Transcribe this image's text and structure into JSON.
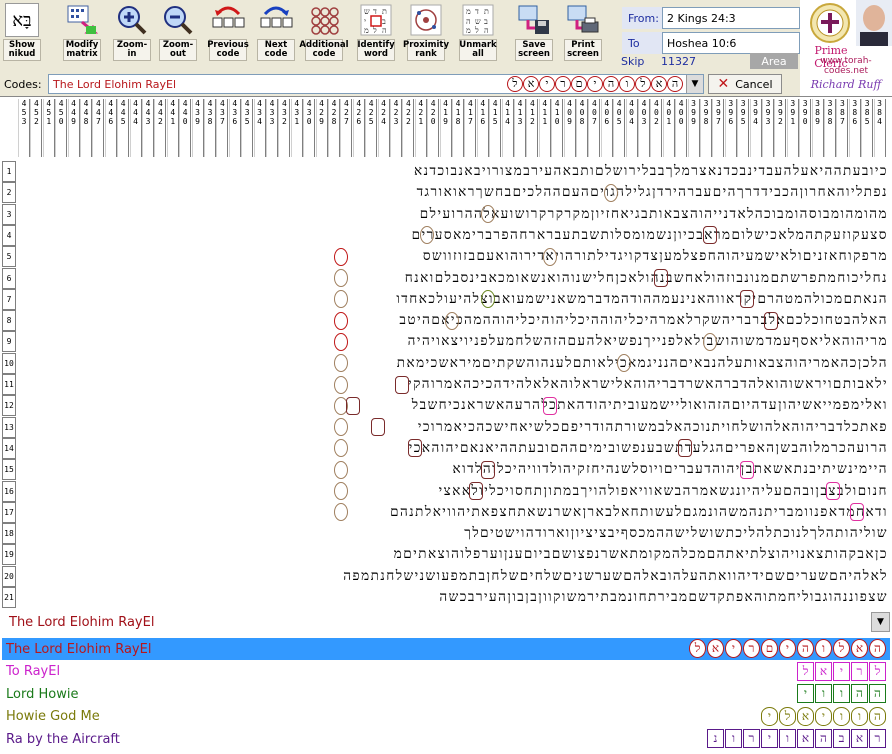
{
  "toolbar": {
    "buttons": [
      {
        "id": "show-nikud",
        "label": "Show\nnikud",
        "icon": "nikud-icon"
      },
      {
        "id": "modify-matrix",
        "label": "Modify\nmatrix",
        "icon": "matrix-icon"
      },
      {
        "id": "zoom-in",
        "label": "Zoom-in",
        "icon": "zoom-in-icon"
      },
      {
        "id": "zoom-out",
        "label": "Zoom-out",
        "icon": "zoom-out-icon"
      },
      {
        "id": "previous-code",
        "label": "Previous\ncode",
        "icon": "previous-icon"
      },
      {
        "id": "next-code",
        "label": "Next\ncode",
        "icon": "next-icon"
      },
      {
        "id": "additional-code",
        "label": "Additional\ncode",
        "icon": "additional-icon"
      },
      {
        "id": "identify-word",
        "label": "Identify\nword",
        "icon": "identify-icon"
      },
      {
        "id": "proximity-rank",
        "label": "Proximity\nrank",
        "icon": "proximity-icon"
      },
      {
        "id": "unmark-all",
        "label": "Unmark\nall",
        "icon": "unmark-icon"
      },
      {
        "id": "save-screen",
        "label": "Save\nscreen",
        "icon": "save-icon"
      },
      {
        "id": "print-screen",
        "label": "Print\nscreen",
        "icon": "print-icon"
      }
    ],
    "nikud_glyph": "בָּא"
  },
  "range": {
    "from_label": "From:",
    "from_value": "2 Kings 24:3",
    "to_label": "To",
    "to_value": "Hoshea 10:6",
    "skip_label": "Skip",
    "skip_value": "11327",
    "area_label": "Area"
  },
  "logo": {
    "title": "Prime Cleric",
    "url": "www.torah-codes.net",
    "signature": "Richard Ruff"
  },
  "codes": {
    "label": "Codes:",
    "selected": "The Lord Elohim RayEl",
    "selected_hebrew": [
      "ה",
      "א",
      "ל",
      "ו",
      "ה",
      "י",
      "ם",
      "ר",
      "י",
      "א",
      "ל"
    ],
    "cancel_label": "Cancel"
  },
  "matrix": {
    "column_numbers": [
      "4\n5\n3",
      "4\n5\n2",
      "4\n5\n1",
      "4\n5\n0",
      "4\n4\n9",
      "4\n4\n8",
      "4\n4\n7",
      "4\n4\n6",
      "4\n4\n5",
      "4\n4\n4",
      "4\n4\n3",
      "4\n4\n2",
      "4\n4\n1",
      "4\n4\n0",
      "4\n3\n9",
      "4\n3\n8",
      "4\n3\n7",
      "4\n3\n6",
      "4\n3\n5",
      "4\n3\n4",
      "4\n3\n3",
      "4\n3\n2",
      "4\n3\n1",
      "4\n3\n0",
      "4\n2\n9",
      "4\n2\n8",
      "4\n2\n7",
      "4\n2\n6",
      "4\n2\n5",
      "4\n2\n4",
      "4\n2\n3",
      "4\n2\n2",
      "4\n2\n1",
      "4\n2\n0",
      "4\n1\n9",
      "4\n1\n8",
      "4\n1\n7",
      "4\n1\n6",
      "4\n1\n5",
      "4\n1\n4",
      "4\n1\n3",
      "4\n1\n2",
      "4\n1\n1",
      "4\n1\n0",
      "4\n0\n9",
      "4\n0\n8",
      "4\n0\n7",
      "4\n0\n6",
      "4\n0\n5",
      "4\n0\n4",
      "4\n0\n3",
      "4\n0\n2",
      "4\n0\n1",
      "4\n0\n0",
      "3\n9\n9",
      "3\n9\n8",
      "3\n9\n7",
      "3\n9\n6",
      "3\n9\n5",
      "3\n9\n4",
      "3\n9\n3",
      "3\n9\n2",
      "3\n9\n1",
      "3\n9\n0",
      "3\n8\n9",
      "3\n8\n8",
      "3\n8\n7",
      "3\n8\n6",
      "3\n8\n5",
      "3\n8\n4"
    ],
    "rows": [
      {
        "n": "1",
        "text": "כיובעתההיאעלהעבדינבכדנאצרמלךבבלירושלםותבאהעירבמצורויבאנבוכדנא"
      },
      {
        "n": "2",
        "text": "נפתליוהאחרוןהכבידדרךהיםעברהירדןגלילהגויםהעםההלכיםבחשךראואורגד"
      },
      {
        "n": "3",
        "text": "מהומהומבוסהומבוכהלאדנייהוהצבאותבגיאחזיוןמקרקרקרושועאלההרועילם"
      },
      {
        "n": "4",
        "text": "סצעקוזעקתהמלאכישלוםמראבכיוןנשמומסלותשבתעברארחהפרברימאסערים"
      },
      {
        "n": "5",
        "text": "מרפקוחאזניםולאישמעיהוהחפצלמעןצדקויגדילתורהויאדירוהואעםבזוזוושס"
      },
      {
        "n": "6",
        "text": "נחליכוחמתפרשתםמנונבוזהולאחשבנהולאכןחלישנוהואנשאומכאבינסבלםואנח"
      },
      {
        "n": "7",
        "text": "הנאתםמכולהמטהרםיקראווהאנינעמההודהמדברמשאנישמעואבוצלהיעולכאחדו"
      },
      {
        "n": "8",
        "text": "האלהבטחוכלכםאלברבריהשקרלאמרהיכליהוההיכליהוהיכליהוההמהכיאםהיטב"
      },
      {
        "n": "9",
        "text": "מריהוהאליאסףעמדמשוהושבולאלפנייךנפשיאלהעםהזהשלחמעלפניויצאויהיה"
      },
      {
        "n": "10",
        "text": "הלכןכהאמריהוהצבאותעלהנבאיםהנניגמאכילאותםלענהוהשקתיםמיראשכימאת"
      },
      {
        "n": "11",
        "text": "ילאבותםויראשוהואלהדברהאשרדבריהוהאלישראלוהאלאלהידהכיכהאמרוהקי"
      },
      {
        "n": "12",
        "text": "ואלימפמייאשיהוןעדהיוםהזהואוליישמעוביתיהודהאתכלהרעהאשראנכיחשבל"
      },
      {
        "n": "13",
        "text": "פאתכלדבריהוהאלהושלחויתנוכהאלבמשורתהודריפםכלשיאחישכהכיאמרוכי"
      },
      {
        "n": "14",
        "text": "הרועהכרמלוהבשןהאפריםהגלעדתשבענפשובימיםההםובעתההיאנאםיהוהאכי"
      },
      {
        "n": "15",
        "text": "היימינשיתיבנתאשאתבןיהוהדעבריםויוסלשנהיחזקיהולדוויהיכלוהלדוא"
      },
      {
        "n": "16",
        "text": "חנוםולבצבןובהםעליהיונגשאמרהבשאוויאפולהויךבמתוןתחסויכליולאאצי"
      },
      {
        "n": "17",
        "text": "ודאחמדאפנוומבריתנהמשהונמגםלעשותחאלבארןאשרנשאתחצפאתיהוויאלתנהם"
      },
      {
        "n": "18",
        "text": "שוליהותהלךלנוכתלהליכתשושלישההמכסףיבציציוןוארודהוישטיםלך"
      },
      {
        "n": "19",
        "text": "כןאבקהותצאנויהוצלתיאתהםמכלהמקומתאשרנפצושםביוםענןוערפלוהוצאתיםמ"
      },
      {
        "n": "20",
        "text": "לאלהיהםשעריםשםידיהוואתהעלהובאלהםשערשניםשלחיםשלחןבתמפעושנישלחנתמפה"
      },
      {
        "n": "21",
        "text": "שצפוננהוגבוליחמתוהאפתקדשםמבירתחונמבתירמשוקווןבןבוןהעירבכשה"
      }
    ],
    "marks": [
      {
        "row": 2,
        "col": 22,
        "kind": "oval"
      },
      {
        "row": 3,
        "col": 32,
        "kind": "oval"
      },
      {
        "row": 4,
        "col": 37,
        "kind": "oval"
      },
      {
        "row": 4,
        "col": 14,
        "kind": "box"
      },
      {
        "row": 5,
        "col": 44,
        "kind": "oval-red"
      },
      {
        "row": 5,
        "col": 27,
        "kind": "oval"
      },
      {
        "row": 6,
        "col": 44,
        "kind": "oval"
      },
      {
        "row": 6,
        "col": 18,
        "kind": "box"
      },
      {
        "row": 7,
        "col": 44,
        "kind": "oval"
      },
      {
        "row": 7,
        "col": 32,
        "kind": "oval-green"
      },
      {
        "row": 7,
        "col": 11,
        "kind": "box"
      },
      {
        "row": 8,
        "col": 44,
        "kind": "oval-red"
      },
      {
        "row": 8,
        "col": 35,
        "kind": "oval"
      },
      {
        "row": 8,
        "col": 9,
        "kind": "box"
      },
      {
        "row": 9,
        "col": 44,
        "kind": "oval-red"
      },
      {
        "row": 9,
        "col": 14,
        "kind": "oval"
      },
      {
        "row": 10,
        "col": 44,
        "kind": "oval"
      },
      {
        "row": 10,
        "col": 21,
        "kind": "oval"
      },
      {
        "row": 11,
        "col": 44,
        "kind": "oval"
      },
      {
        "row": 11,
        "col": 39,
        "kind": "box"
      },
      {
        "row": 12,
        "col": 44,
        "kind": "oval"
      },
      {
        "row": 12,
        "col": 43,
        "kind": "box"
      },
      {
        "row": 12,
        "col": 27,
        "kind": "box-pink"
      },
      {
        "row": 13,
        "col": 44,
        "kind": "oval"
      },
      {
        "row": 13,
        "col": 41,
        "kind": "box"
      },
      {
        "row": 14,
        "col": 44,
        "kind": "oval"
      },
      {
        "row": 14,
        "col": 38,
        "kind": "box"
      },
      {
        "row": 14,
        "col": 16,
        "kind": "box"
      },
      {
        "row": 15,
        "col": 44,
        "kind": "oval"
      },
      {
        "row": 15,
        "col": 32,
        "kind": "box"
      },
      {
        "row": 15,
        "col": 11,
        "kind": "box-pink"
      },
      {
        "row": 16,
        "col": 44,
        "kind": "oval"
      },
      {
        "row": 16,
        "col": 33,
        "kind": "box"
      },
      {
        "row": 16,
        "col": 4,
        "kind": "box-pink"
      },
      {
        "row": 17,
        "col": 44,
        "kind": "oval"
      },
      {
        "row": 17,
        "col": 2,
        "kind": "box-pink"
      }
    ]
  },
  "results": {
    "selected": "The Lord Elohim RayEl",
    "items": [
      {
        "name": "The Lord Elohim RayEl",
        "color": "#b8171b",
        "active": true,
        "hebrew": [
          "ה",
          "א",
          "ל",
          "ו",
          "ה",
          "י",
          "ם",
          "ר",
          "י",
          "א",
          "ל"
        ],
        "shape": "circ"
      },
      {
        "name": "To RayEl",
        "color": "#cc22cc",
        "active": false,
        "hebrew": [
          "ל",
          "ר",
          "י",
          "א",
          "ל"
        ],
        "shape": "box"
      },
      {
        "name": "Lord Howie",
        "color": "#1a7a1a",
        "active": false,
        "hebrew": [
          "ה",
          "ה",
          "ו",
          "ו",
          "י"
        ],
        "shape": "box"
      },
      {
        "name": "Howie God Me",
        "color": "#7a7a0a",
        "active": false,
        "hebrew": [
          "ה",
          "ו",
          "ו",
          "י",
          "א",
          "ל",
          "י"
        ],
        "shape": "oval"
      },
      {
        "name": "Ra by the Aircraft",
        "color": "#5a1a8a",
        "active": false,
        "hebrew": [
          "ר",
          "א",
          "ב",
          "ה",
          "א",
          "ו",
          "י",
          "ר",
          "ו",
          "נ"
        ],
        "shape": "box"
      }
    ]
  }
}
